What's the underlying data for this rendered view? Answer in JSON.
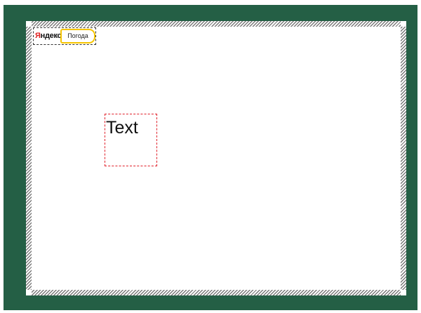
{
  "widget": {
    "logo_first_letter": "Я",
    "logo_rest": "ндекс",
    "weather_label": "Погода"
  },
  "canvas": {
    "text_label": "Text"
  },
  "colors": {
    "frame": "#245f45",
    "accent_yellow": "#f5c400",
    "selection_red": "#e0202a"
  }
}
